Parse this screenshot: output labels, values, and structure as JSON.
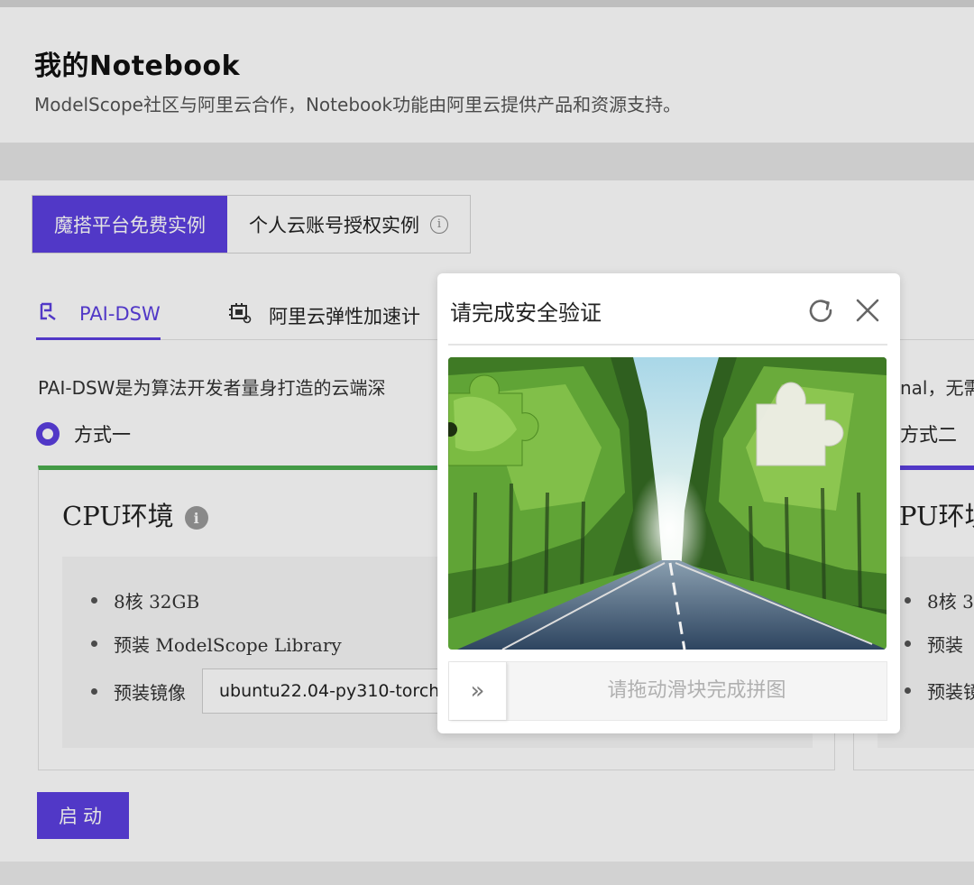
{
  "header": {
    "title": "我的Notebook",
    "subtitle": "ModelScope社区与阿里云合作，Notebook功能由阿里云提供产品和资源支持。"
  },
  "instance_tabs": [
    {
      "label": "魔搭平台免费实例",
      "active": true
    },
    {
      "label": "个人云账号授权实例",
      "active": false
    }
  ],
  "platform_tabs": [
    {
      "label": "PAI-DSW",
      "active": true
    },
    {
      "label": "阿里云弹性加速计",
      "active": false
    }
  ],
  "description": {
    "left": "PAI-DSW是为算法开发者量身打造的云端深",
    "right": "nal，无需"
  },
  "options": {
    "option1": "方式一",
    "option2": "方式二"
  },
  "cards": [
    {
      "title": "CPU环境",
      "specs": [
        "8核 32GB",
        "预装 ModelScope Library",
        "预装镜像"
      ],
      "image_value": "ubuntu22.04-py310-torch"
    },
    {
      "title": "PU环境",
      "specs": [
        "8核 3",
        "预装",
        "预装镜"
      ]
    }
  ],
  "start_button": "启动",
  "captcha": {
    "title": "请完成安全验证",
    "slider_hint": "请拖动滑块完成拼图",
    "handle_glyph": "»",
    "image": "road-through-green-forest"
  },
  "colors": {
    "accent": "#5b3fe0",
    "option1_bar": "#4cae4f",
    "option2_bar": "#5b3fe0"
  }
}
